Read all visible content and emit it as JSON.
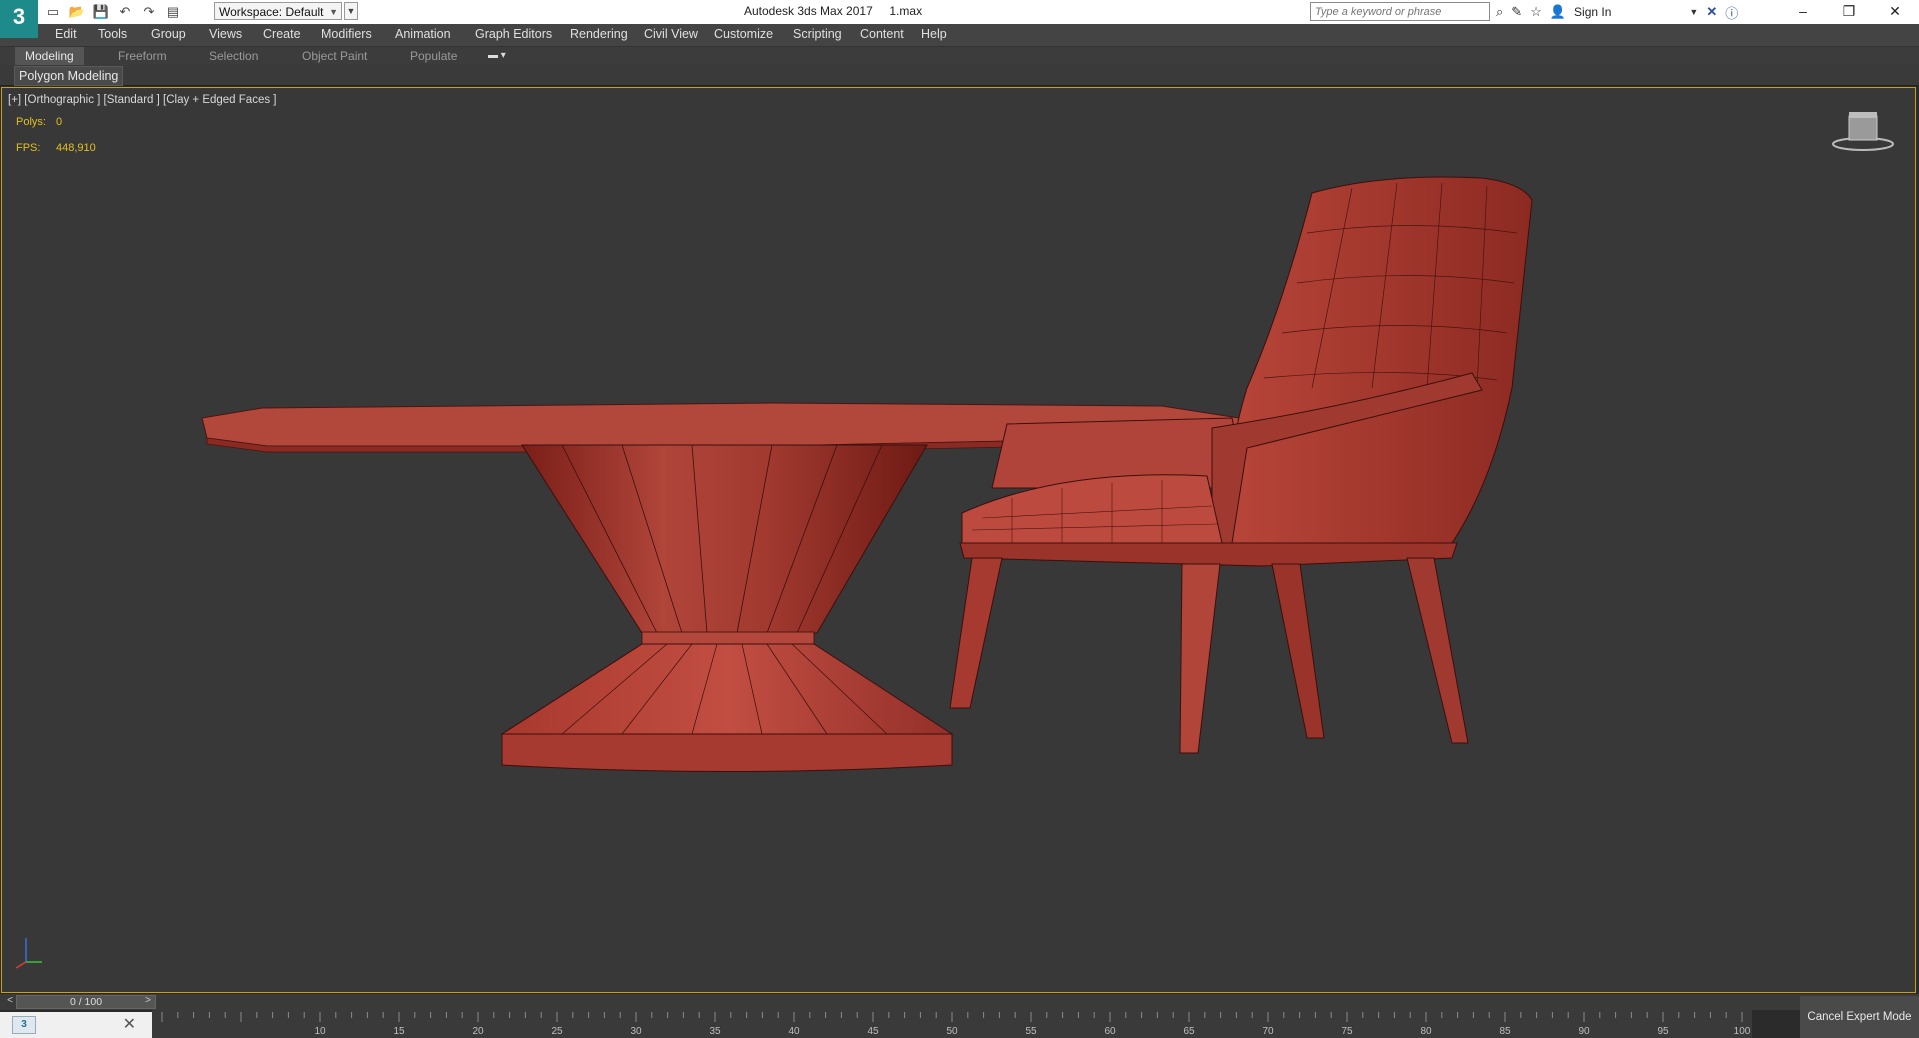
{
  "app": {
    "logo_text": "3",
    "window_title": "Autodesk 3ds Max 2017",
    "file_name": "1.max",
    "workspace_label": "Workspace: Default",
    "search_placeholder": "Type a keyword or phrase",
    "sign_in": "Sign In",
    "window_controls": [
      "minimize",
      "restore",
      "close"
    ]
  },
  "menu": {
    "items": [
      "Edit",
      "Tools",
      "Group",
      "Views",
      "Create",
      "Modifiers",
      "Animation",
      "Graph Editors",
      "Rendering",
      "Civil View",
      "Customize",
      "Scripting",
      "Content",
      "Help"
    ]
  },
  "ribbon": {
    "tabs": [
      "Modeling",
      "Freeform",
      "Selection",
      "Object Paint",
      "Populate"
    ],
    "active_tab": "Modeling",
    "panel": "Polygon Modeling"
  },
  "viewport": {
    "label": "[+] [Orthographic ] [Standard ] [Clay + Edged Faces ]",
    "polys_label": "Polys:",
    "polys_value": "0",
    "fps_label": "FPS:",
    "fps_value": "448,910",
    "object_color": "#a8362c",
    "border_color": "#c8a020"
  },
  "timeline": {
    "frame_display": "0 / 100",
    "ticks": [
      "10",
      "15",
      "20",
      "25",
      "30",
      "35",
      "40",
      "45",
      "50",
      "55",
      "60",
      "65",
      "70",
      "75",
      "80",
      "85",
      "90",
      "95",
      "100"
    ]
  },
  "status": {
    "cancel_expert_mode": "Cancel Expert Mode"
  }
}
